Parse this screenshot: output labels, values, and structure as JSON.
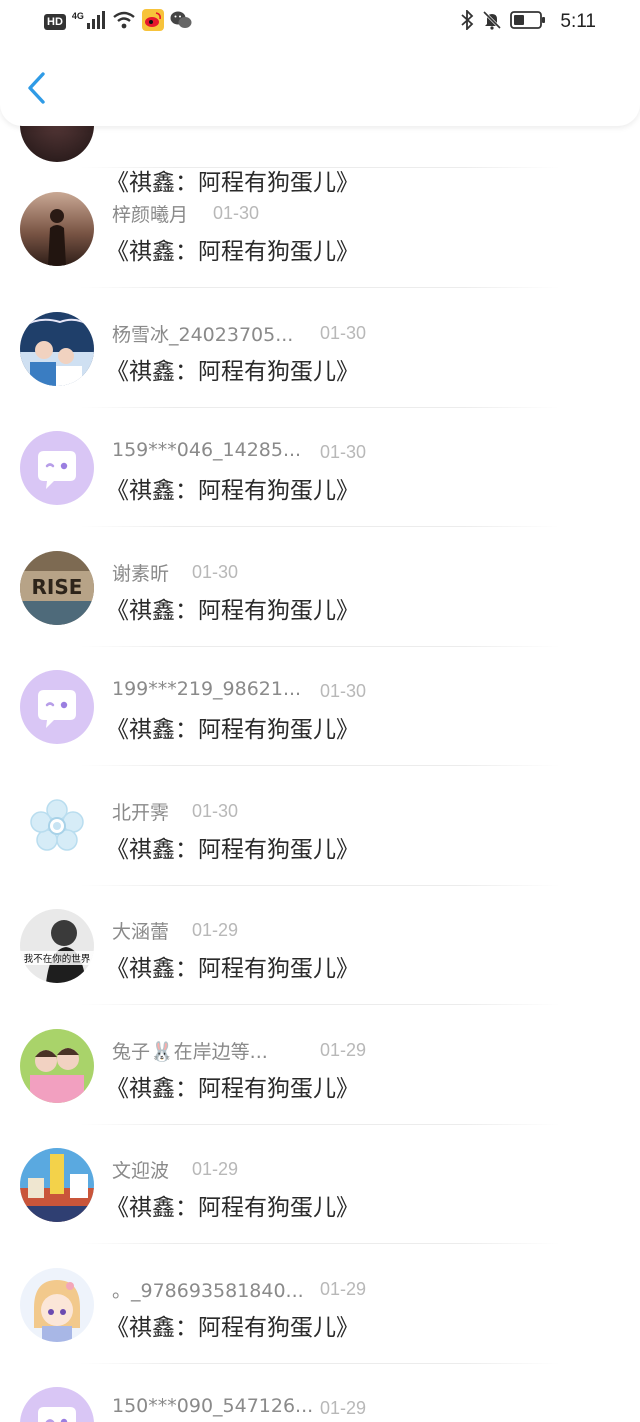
{
  "status_bar": {
    "hd_label": "HD",
    "network_label": "4G",
    "time": "5:11"
  },
  "nav": {
    "back_icon": "chevron-left-icon"
  },
  "colors": {
    "accent": "#2f9be6",
    "name_text": "#8a8a8a",
    "date_text": "#b8b8b8",
    "message_text": "#2a2a2a",
    "default_avatar_bg": "#d9c6f5"
  },
  "partial_top_item": {
    "message": "《祺鑫：阿程有狗蛋儿》"
  },
  "items": [
    {
      "name": "梓颜曦月",
      "date": "01-30",
      "message": "《祺鑫：阿程有狗蛋儿》",
      "avatar": "photo-avatar"
    },
    {
      "name": "杨雪冰_24023705...",
      "date": "01-30",
      "message": "《祺鑫：阿程有狗蛋儿》",
      "avatar": "photo-avatar"
    },
    {
      "name": "159***046_14285...",
      "date": "01-30",
      "message": "《祺鑫：阿程有狗蛋儿》",
      "avatar": "default-chat-avatar"
    },
    {
      "name": "谢素昕",
      "date": "01-30",
      "message": "《祺鑫：阿程有狗蛋儿》",
      "avatar": "photo-avatar",
      "avatar_text": "RISE"
    },
    {
      "name": "199***219_98621...",
      "date": "01-30",
      "message": "《祺鑫：阿程有狗蛋儿》",
      "avatar": "default-chat-avatar"
    },
    {
      "name": "北开霁",
      "date": "01-30",
      "message": "《祺鑫：阿程有狗蛋儿》",
      "avatar": "flower-avatar"
    },
    {
      "name": "大涵蕾",
      "date": "01-29",
      "message": "《祺鑫：阿程有狗蛋儿》",
      "avatar": "photo-avatar",
      "avatar_text": "我不在你的世界"
    },
    {
      "name": "兔子🐰在岸边等...",
      "date": "01-29",
      "message": "《祺鑫：阿程有狗蛋儿》",
      "avatar": "photo-avatar"
    },
    {
      "name": "文迎波",
      "date": "01-29",
      "message": "《祺鑫：阿程有狗蛋儿》",
      "avatar": "photo-avatar"
    },
    {
      "name": "。_978693581840...",
      "date": "01-29",
      "message": "《祺鑫：阿程有狗蛋儿》",
      "avatar": "anime-avatar"
    },
    {
      "name": "150***090_547126...",
      "date": "01-29",
      "message": "",
      "avatar": "default-chat-avatar"
    }
  ]
}
